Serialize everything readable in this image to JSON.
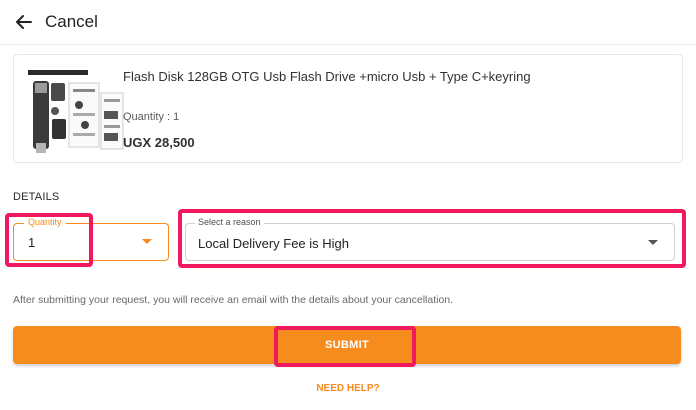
{
  "header": {
    "back_icon": "arrow-left-icon",
    "title": "Cancel"
  },
  "product": {
    "image_icon": "usb-flash-drive-image",
    "name": "Flash Disk 128GB OTG Usb Flash Drive +micro Usb + Type C+keyring",
    "quantity_label": "Quantity : 1",
    "price": "UGX 28,500"
  },
  "details": {
    "heading": "DETAILS",
    "quantity": {
      "legend": "Quantity",
      "value": "1"
    },
    "reason": {
      "legend": "Select a reason",
      "value": "Local Delivery Fee is High"
    },
    "info_text": "After submitting your request, you will receive an email with the details about your cancellation."
  },
  "actions": {
    "submit_label": "SUBMIT",
    "help_label": "NEED HELP?"
  },
  "colors": {
    "accent": "#f68b1e",
    "highlight": "#f0195e"
  }
}
